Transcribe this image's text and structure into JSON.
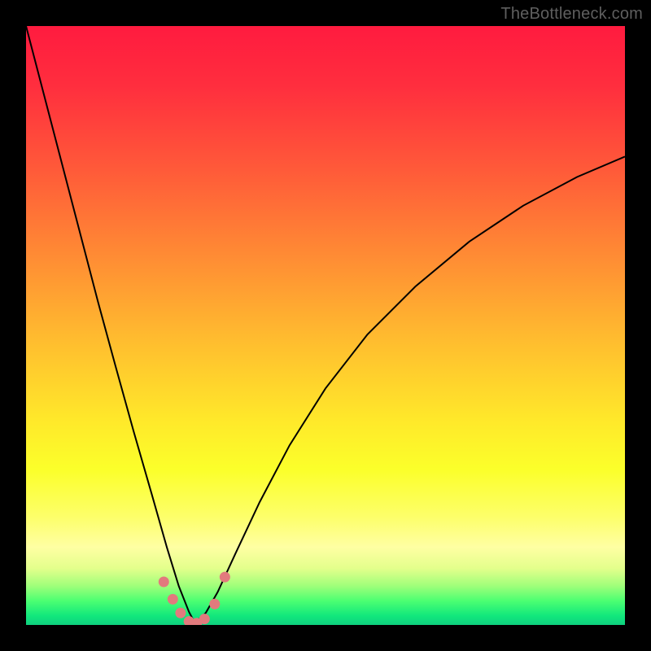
{
  "watermark": "TheBottleneck.com",
  "colors": {
    "gradient_stops": [
      {
        "offset": 0.0,
        "color": "#ff1b3f"
      },
      {
        "offset": 0.1,
        "color": "#ff2e3e"
      },
      {
        "offset": 0.24,
        "color": "#ff5a39"
      },
      {
        "offset": 0.38,
        "color": "#ff8a34"
      },
      {
        "offset": 0.52,
        "color": "#ffbb2f"
      },
      {
        "offset": 0.66,
        "color": "#ffe92a"
      },
      {
        "offset": 0.74,
        "color": "#fbff2a"
      },
      {
        "offset": 0.82,
        "color": "#fdff6a"
      },
      {
        "offset": 0.87,
        "color": "#feffa3"
      },
      {
        "offset": 0.905,
        "color": "#e4ff8c"
      },
      {
        "offset": 0.935,
        "color": "#9fff7a"
      },
      {
        "offset": 0.96,
        "color": "#4bff72"
      },
      {
        "offset": 0.985,
        "color": "#11e77c"
      },
      {
        "offset": 1.0,
        "color": "#0fd07f"
      }
    ],
    "curve": "#000000",
    "marker": "#e27a7d"
  },
  "chart_data": {
    "type": "line",
    "title": "",
    "xlabel": "",
    "ylabel": "",
    "xlim": [
      0,
      1
    ],
    "ylim": [
      0,
      1
    ],
    "notes": "Bottleneck-style V-curve. x is normalized horizontal position across the colored plot area; y is normalized from bottom (0 = bottom/green, 1 = top/red). Curve reaches a minimum near x≈0.28. Right branch rises with diminishing slope and exits near the right edge around y≈0.78. Values are visual estimates.",
    "series": [
      {
        "name": "left_branch",
        "x": [
          0.0,
          0.03,
          0.06,
          0.09,
          0.12,
          0.15,
          0.18,
          0.21,
          0.235,
          0.255,
          0.272,
          0.282
        ],
        "y": [
          1.0,
          0.885,
          0.77,
          0.655,
          0.54,
          0.43,
          0.322,
          0.218,
          0.13,
          0.065,
          0.022,
          0.003
        ]
      },
      {
        "name": "right_branch",
        "x": [
          0.282,
          0.3,
          0.32,
          0.35,
          0.39,
          0.44,
          0.5,
          0.57,
          0.65,
          0.74,
          0.83,
          0.92,
          1.0
        ],
        "y": [
          0.003,
          0.02,
          0.055,
          0.12,
          0.205,
          0.3,
          0.395,
          0.485,
          0.565,
          0.64,
          0.7,
          0.748,
          0.782
        ]
      }
    ],
    "markers": {
      "name": "highlight_points_near_minimum",
      "x": [
        0.23,
        0.245,
        0.258,
        0.272,
        0.285,
        0.298,
        0.315,
        0.332
      ],
      "y": [
        0.072,
        0.043,
        0.02,
        0.006,
        0.003,
        0.01,
        0.035,
        0.08
      ]
    }
  }
}
